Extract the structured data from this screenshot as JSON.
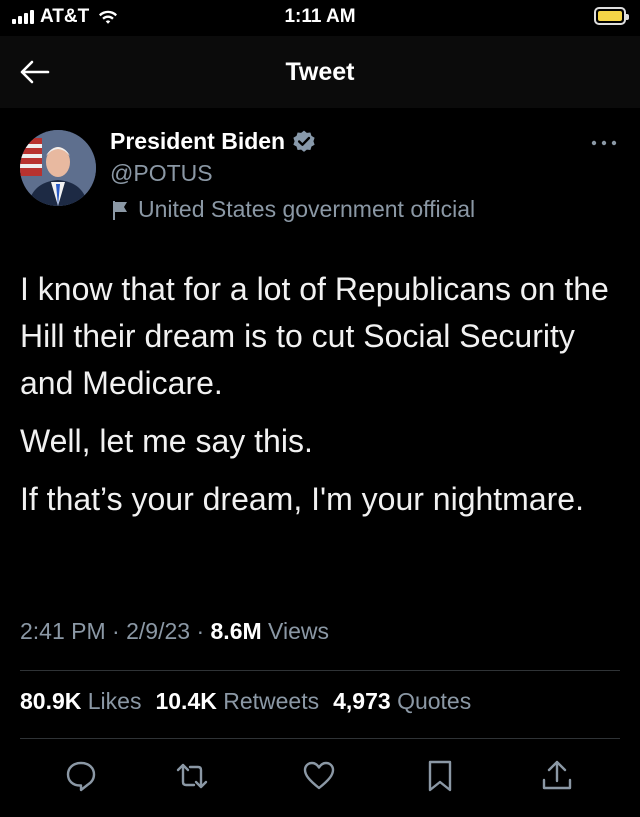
{
  "status_bar": {
    "carrier": "AT&T",
    "time": "1:11 AM",
    "battery_color": "#f5d547"
  },
  "nav": {
    "title": "Tweet",
    "back_icon": "arrow-left-icon"
  },
  "author": {
    "name": "President Biden",
    "handle": "@POTUS",
    "label": "United States government official",
    "verified_color": "#8899aa"
  },
  "tweet": {
    "paragraphs": [
      "I know that for a lot of Republicans on the Hill their dream is to cut Social Security and Medicare.",
      "Well, let me say this.",
      "If that’s your dream, I'm your nightmare."
    ],
    "time": "2:41 PM",
    "date": "2/9/23",
    "views_count": "8.6M",
    "views_label": "Views"
  },
  "stats": {
    "likes_count": "80.9K",
    "likes_label": "Likes",
    "retweets_count": "10.4K",
    "retweets_label": "Retweets",
    "quotes_count": "4,973",
    "quotes_label": "Quotes"
  },
  "actions": [
    "reply-icon",
    "retweet-icon",
    "like-icon",
    "bookmark-icon",
    "share-icon"
  ],
  "colors": {
    "background": "#000000",
    "text": "#e7e9ea",
    "secondary": "#8b98a5",
    "divider": "#2f3336"
  }
}
